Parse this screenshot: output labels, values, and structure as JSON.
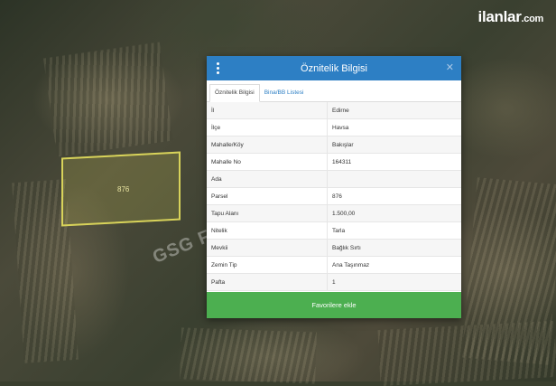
{
  "logo": {
    "main": "ilanlar",
    "suffix": ".com"
  },
  "map": {
    "parcel_label": "876",
    "watermark": "GSG F"
  },
  "dialog": {
    "title": "Öznitelik Bilgisi",
    "tabs": [
      {
        "label": "Öznitelik Bilgisi",
        "active": true
      },
      {
        "label": "Bina/BB Listesi",
        "active": false
      }
    ],
    "rows": [
      {
        "key": "İl",
        "value": "Edirne"
      },
      {
        "key": "İlçe",
        "value": "Havsa"
      },
      {
        "key": "Mahalle/Köy",
        "value": "Bakışlar"
      },
      {
        "key": "Mahalle No",
        "value": "164311"
      },
      {
        "key": "Ada",
        "value": ""
      },
      {
        "key": "Parsel",
        "value": "876"
      },
      {
        "key": "Tapu Alanı",
        "value": "1.500,00"
      },
      {
        "key": "Nitelik",
        "value": "Tarla"
      },
      {
        "key": "Mevkii",
        "value": "Bağlık Sırtı"
      },
      {
        "key": "Zemin Tip",
        "value": "Ana Taşınmaz"
      },
      {
        "key": "Pafta",
        "value": "1"
      }
    ],
    "favorite_button": "Favorilere ekle"
  },
  "colors": {
    "header": "#2d7fc4",
    "button": "#4caf50",
    "parcel": "#d8d35a"
  },
  "icons": {
    "menu": "kebab-menu-icon",
    "close": "close-icon"
  }
}
